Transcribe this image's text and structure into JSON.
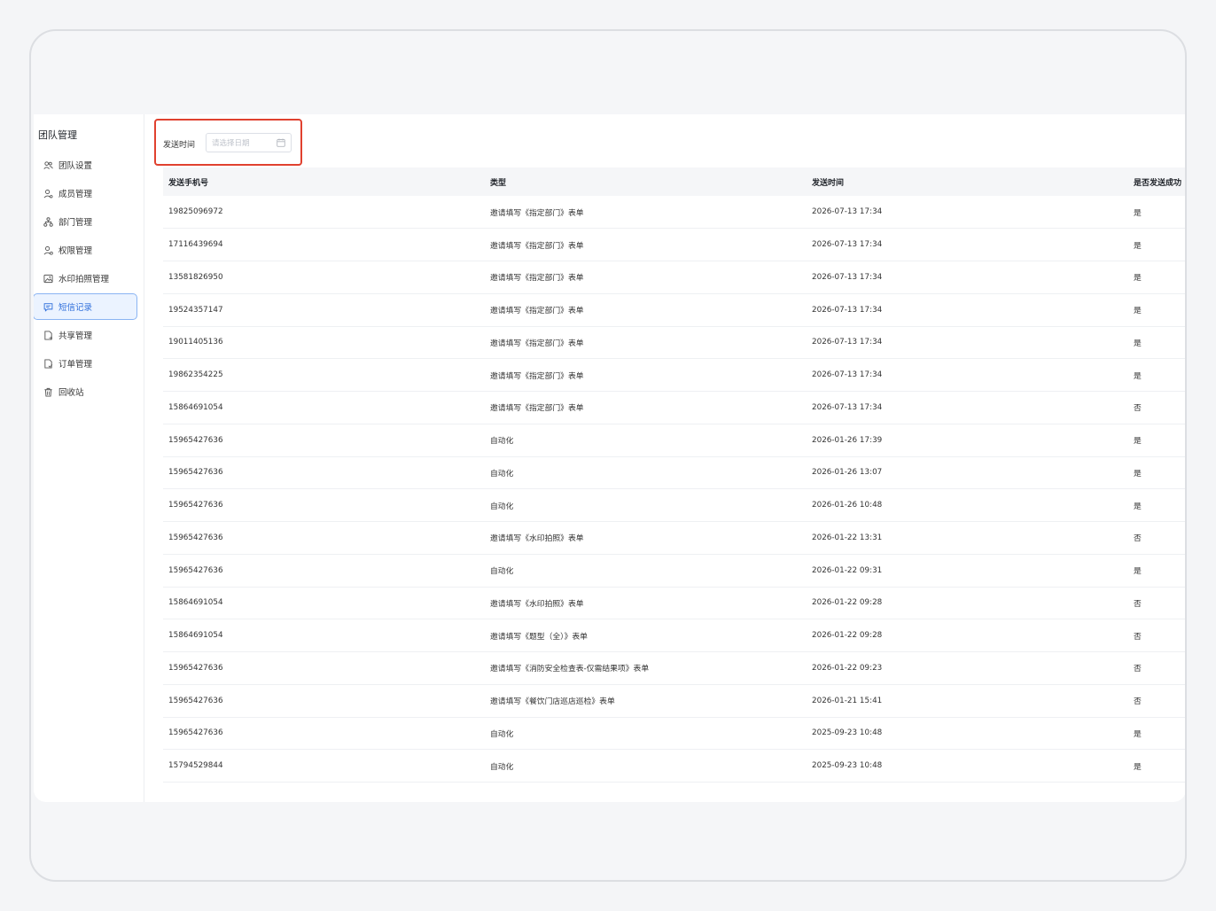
{
  "sidebar": {
    "title": "团队管理",
    "items": [
      {
        "label": "团队设置",
        "icon": "team-icon",
        "active": false
      },
      {
        "label": "成员管理",
        "icon": "user-icon",
        "active": false
      },
      {
        "label": "部门管理",
        "icon": "org-chart-icon",
        "active": false
      },
      {
        "label": "权限管理",
        "icon": "user-key-icon",
        "active": false
      },
      {
        "label": "水印拍照管理",
        "icon": "image-icon",
        "active": false
      },
      {
        "label": "短信记录",
        "icon": "message-icon",
        "active": true
      },
      {
        "label": "共享管理",
        "icon": "share-doc-icon",
        "active": false
      },
      {
        "label": "订单管理",
        "icon": "order-doc-icon",
        "active": false
      },
      {
        "label": "回收站",
        "icon": "recycle-bin-icon",
        "active": false
      }
    ]
  },
  "filter": {
    "label": "发送时间",
    "date_placeholder": "请选择日期"
  },
  "table": {
    "headers": [
      "发送手机号",
      "类型",
      "发送时间",
      "是否发送成功"
    ],
    "rows": [
      [
        "19825096972",
        "邀请填写《指定部门》表单",
        "2026-07-13 17:34",
        "是"
      ],
      [
        "17116439694",
        "邀请填写《指定部门》表单",
        "2026-07-13 17:34",
        "是"
      ],
      [
        "13581826950",
        "邀请填写《指定部门》表单",
        "2026-07-13 17:34",
        "是"
      ],
      [
        "19524357147",
        "邀请填写《指定部门》表单",
        "2026-07-13 17:34",
        "是"
      ],
      [
        "19011405136",
        "邀请填写《指定部门》表单",
        "2026-07-13 17:34",
        "是"
      ],
      [
        "19862354225",
        "邀请填写《指定部门》表单",
        "2026-07-13 17:34",
        "是"
      ],
      [
        "15864691054",
        "邀请填写《指定部门》表单",
        "2026-07-13 17:34",
        "否"
      ],
      [
        "15965427636",
        "自动化",
        "2026-01-26 17:39",
        "是"
      ],
      [
        "15965427636",
        "自动化",
        "2026-01-26 13:07",
        "是"
      ],
      [
        "15965427636",
        "自动化",
        "2026-01-26 10:48",
        "是"
      ],
      [
        "15965427636",
        "邀请填写《水印拍照》表单",
        "2026-01-22 13:31",
        "否"
      ],
      [
        "15965427636",
        "自动化",
        "2026-01-22 09:31",
        "是"
      ],
      [
        "15864691054",
        "邀请填写《水印拍照》表单",
        "2026-01-22 09:28",
        "否"
      ],
      [
        "15864691054",
        "邀请填写《题型（全）》表单",
        "2026-01-22 09:28",
        "否"
      ],
      [
        "15965427636",
        "邀请填写《消防安全检查表-仅需结果项》表单",
        "2026-01-22 09:23",
        "否"
      ],
      [
        "15965427636",
        "邀请填写《餐饮门店巡店巡检》表单",
        "2026-01-21 15:41",
        "否"
      ],
      [
        "15965427636",
        "自动化",
        "2025-09-23 10:48",
        "是"
      ],
      [
        "15794529844",
        "自动化",
        "2025-09-23 10:48",
        "是"
      ]
    ]
  },
  "colors": {
    "accent": "#2f6fdb",
    "active_bg": "#ebf3ff",
    "highlight_border": "#e0412f"
  }
}
